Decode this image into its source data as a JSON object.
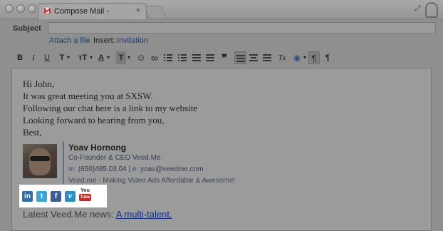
{
  "browser": {
    "tab_title": "Compose Mail -",
    "tab_close": "×"
  },
  "compose": {
    "subject_label": "Subject",
    "subject_value": "",
    "attach_link": "Attach a file",
    "insert_label": "Insert:",
    "insert_link": "Invitation"
  },
  "toolbar": {
    "bold": "B",
    "italic": "I",
    "underline": "U",
    "font": "T",
    "font_size": "тT",
    "text_color": "A",
    "bg_color": "T",
    "emoji": "☺",
    "link": "∞",
    "quote": "❞",
    "remove_format": "Tx",
    "rtl": "¶",
    "ltr": "¶",
    "dropdown_caret": "▾"
  },
  "message": {
    "lines": [
      "Hi John,",
      "It was great meeting you at SXSW.",
      "Following our chat here is a link to my website",
      "Looking forward to hearing from you,",
      "Best,"
    ]
  },
  "signature": {
    "name": "Yoav Hornong",
    "title": "Co-Founder & CEO  Veed.Me",
    "phone_label": "m:",
    "phone": "(650)485.03.04",
    "separator": "|",
    "email_label": "e:",
    "email": "yoav@veedme.com",
    "tagline": "Veed.me - Making Video Ads Affordable & Awesome!"
  },
  "social": {
    "linkedin": "in",
    "twitter": "t",
    "facebook": "f",
    "vimeo": "v",
    "youtube_top": "You",
    "youtube_bottom": "Tube"
  },
  "news": {
    "label": "Latest Veed.Me news:",
    "link": "A multi-talent."
  },
  "colors": {
    "overlay_gray": "#8f8f8f",
    "link_blue": "#1d3e73",
    "gmail_red": "#c2362a",
    "social_highlight": "#ffffff"
  }
}
